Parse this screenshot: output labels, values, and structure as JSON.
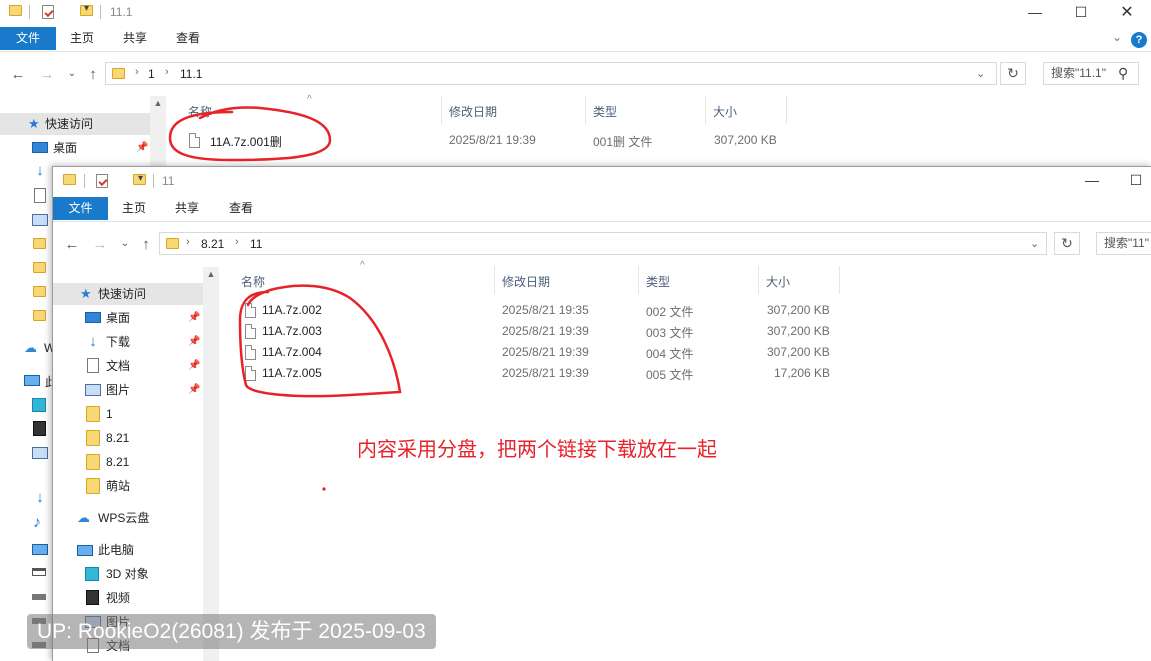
{
  "back_window": {
    "title": "11.1",
    "ribbon": {
      "file": "文件",
      "home": "主页",
      "share": "共享",
      "view": "查看"
    },
    "help": "?",
    "path": [
      "1",
      "11.1"
    ],
    "search_placeholder": "搜索\"11.1\"",
    "columns": {
      "name": "名称",
      "date": "修改日期",
      "type": "类型",
      "size": "大小"
    },
    "files": [
      {
        "name": "11A.7z.001删",
        "date": "2025/8/21 19:39",
        "type": "001删 文件",
        "size": "307,200 KB"
      }
    ],
    "nav": {
      "quick_access": "快速访问",
      "desktop": "桌面",
      "wps_cut": "W",
      "pc_cut": "此"
    }
  },
  "front_window": {
    "title": "11",
    "ribbon": {
      "file": "文件",
      "home": "主页",
      "share": "共享",
      "view": "查看"
    },
    "path": [
      "8.21",
      "11"
    ],
    "search_placeholder": "搜索\"11\"",
    "columns": {
      "name": "名称",
      "date": "修改日期",
      "type": "类型",
      "size": "大小"
    },
    "files": [
      {
        "name": "11A.7z.002",
        "date": "2025/8/21 19:35",
        "type": "002 文件",
        "size": "307,200 KB"
      },
      {
        "name": "11A.7z.003",
        "date": "2025/8/21 19:39",
        "type": "003 文件",
        "size": "307,200 KB"
      },
      {
        "name": "11A.7z.004",
        "date": "2025/8/21 19:39",
        "type": "004 文件",
        "size": "307,200 KB"
      },
      {
        "name": "11A.7z.005",
        "date": "2025/8/21 19:39",
        "type": "005 文件",
        "size": "17,206 KB"
      }
    ],
    "nav": {
      "quick_access": "快速访问",
      "desktop": "桌面",
      "downloads": "下载",
      "documents": "文档",
      "pictures": "图片",
      "folder_1": "1",
      "folder_821a": "8.21",
      "folder_821b": "8.21",
      "folder_mengzhan": "萌站",
      "wps_cloud": "WPS云盘",
      "this_pc": "此电脑",
      "objects_3d": "3D 对象",
      "videos": "视频",
      "pc_pictures": "图片",
      "pc_documents": "文档"
    }
  },
  "annotation_text": "内容采用分盘，把两个链接下载放在一起",
  "watermark": "UP: RookieO2(26081) 发布于 2025-09-03",
  "colors": {
    "file_tab": "#1979ca",
    "annotation": "#e6232a",
    "selected": "#cce8ff",
    "folder": "#f8d775"
  }
}
